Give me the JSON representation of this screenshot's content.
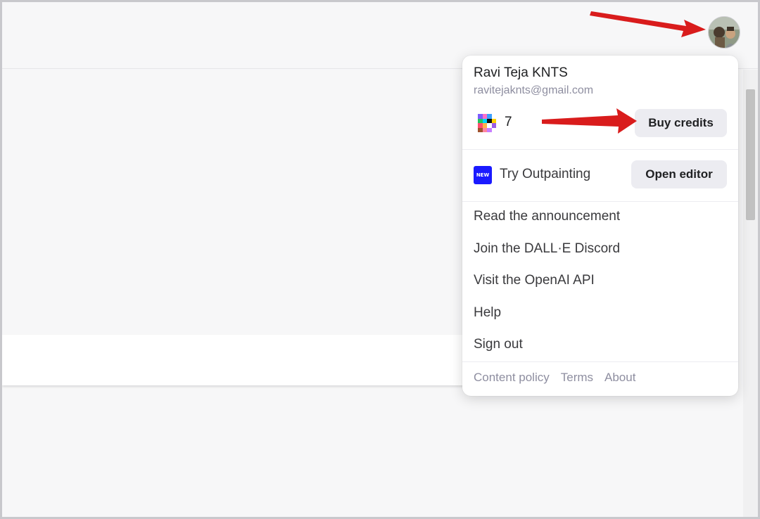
{
  "account": {
    "name": "Ravi Teja KNTS",
    "email": "ravitejaknts@gmail.com"
  },
  "credits": {
    "count": "7",
    "buy_label": "Buy credits"
  },
  "outpainting": {
    "badge": "NEW",
    "label": "Try Outpainting",
    "button": "Open editor"
  },
  "links": [
    "Read the announcement",
    "Join the DALL·E Discord",
    "Visit the OpenAI API",
    "Help",
    "Sign out"
  ],
  "footer": [
    "Content policy",
    "Terms",
    "About"
  ],
  "colors": {
    "annotation_arrow": "#d91c1c",
    "new_badge": "#1a1aff",
    "button_bg": "#ececf1"
  },
  "icons": {
    "avatar": "user-avatar-photo",
    "credits": "pixel-grid-credits-icon"
  }
}
